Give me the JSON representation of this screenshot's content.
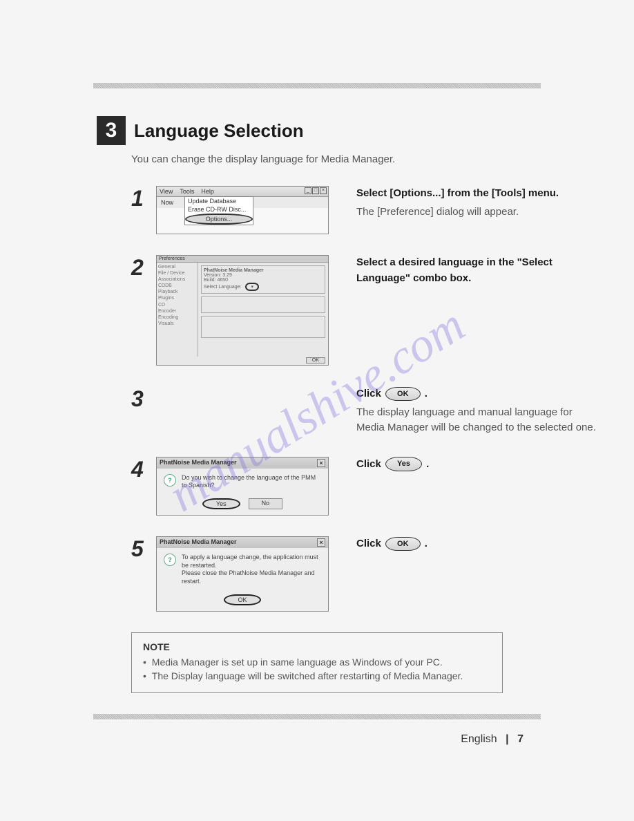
{
  "section": {
    "number": "3",
    "title": "Language Selection",
    "intro": "You can change the display language for Media Manager."
  },
  "steps": {
    "s1": {
      "num": "1",
      "menubar": {
        "view": "View",
        "tools": "Tools",
        "help": "Help"
      },
      "toolbar_item": "Now",
      "dropdown": {
        "item1": "Update Database",
        "item2": "Erase CD-RW Disc...",
        "item3": "Options..."
      },
      "bold": "Select [Options...] from the [Tools] menu.",
      "regular": "The [Preference] dialog will appear."
    },
    "s2": {
      "num": "2",
      "pref_title": "Preferences",
      "nav": [
        "General",
        "File / Device Associations",
        "CDDB",
        "Playback",
        "Plugins",
        "CD",
        "Encoder",
        "Encoding",
        "Visuals"
      ],
      "group_title": "PhatNoise Media Manager",
      "ver": "Version: 3.29",
      "build": "Build: 4650",
      "lang_label": "Select Language:",
      "btn_ok": "OK",
      "bold": "Select a desired language in the \"Select Language\" combo box."
    },
    "s3": {
      "num": "3",
      "click": "Click",
      "btn": "OK",
      "period": ".",
      "regular": "The display language and manual language for Media Manager will be changed to the selected one."
    },
    "s4": {
      "num": "4",
      "dialog_title": "PhatNoise Media Manager",
      "dialog_text": "Do you wish to change the language of the PMM to Spanish?",
      "yes": "Yes",
      "no": "No",
      "click": "Click",
      "btn": "Yes",
      "period": "."
    },
    "s5": {
      "num": "5",
      "dialog_title": "PhatNoise Media Manager",
      "dialog_line1": "To apply a language change, the application must be restarted.",
      "dialog_line2": "Please close the PhatNoise Media Manager and restart.",
      "ok": "OK",
      "click": "Click",
      "btn": "OK",
      "period": "."
    }
  },
  "note": {
    "title": "NOTE",
    "item1": "Media Manager is set up in same language as Windows of your PC.",
    "item2": "The Display language will be switched after restarting of Media Manager."
  },
  "footer": {
    "lang": "English",
    "page": "7"
  },
  "watermark": "manualshive.com"
}
